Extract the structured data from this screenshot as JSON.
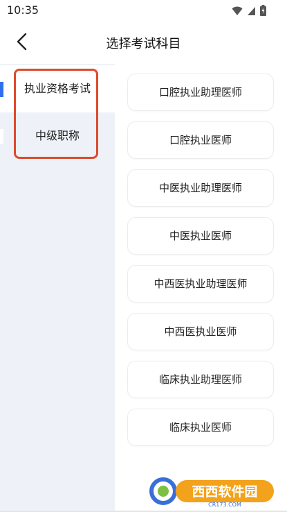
{
  "status_bar": {
    "time": "10:35",
    "icons": [
      "wifi-icon",
      "signal-icon",
      "battery-charging-icon"
    ]
  },
  "header": {
    "title": "选择考试科目",
    "back_icon": "chevron-left-icon"
  },
  "sidebar": {
    "items": [
      {
        "label": "执业资格考试",
        "active": true
      },
      {
        "label": "中级职称",
        "active": false
      }
    ],
    "active_color": "#2f6fef",
    "background": "#eef2f8"
  },
  "subjects": [
    {
      "label": "口腔执业助理医师"
    },
    {
      "label": "口腔执业医师"
    },
    {
      "label": "中医执业助理医师"
    },
    {
      "label": "中医执业医师"
    },
    {
      "label": "中西医执业助理医师"
    },
    {
      "label": "中西医执业医师"
    },
    {
      "label": "临床执业助理医师"
    },
    {
      "label": "临床执业医师"
    }
  ],
  "watermark": {
    "logo_text": "西西软件园",
    "site": "CR173.COM"
  },
  "highlight_color": "#dd4a2c"
}
